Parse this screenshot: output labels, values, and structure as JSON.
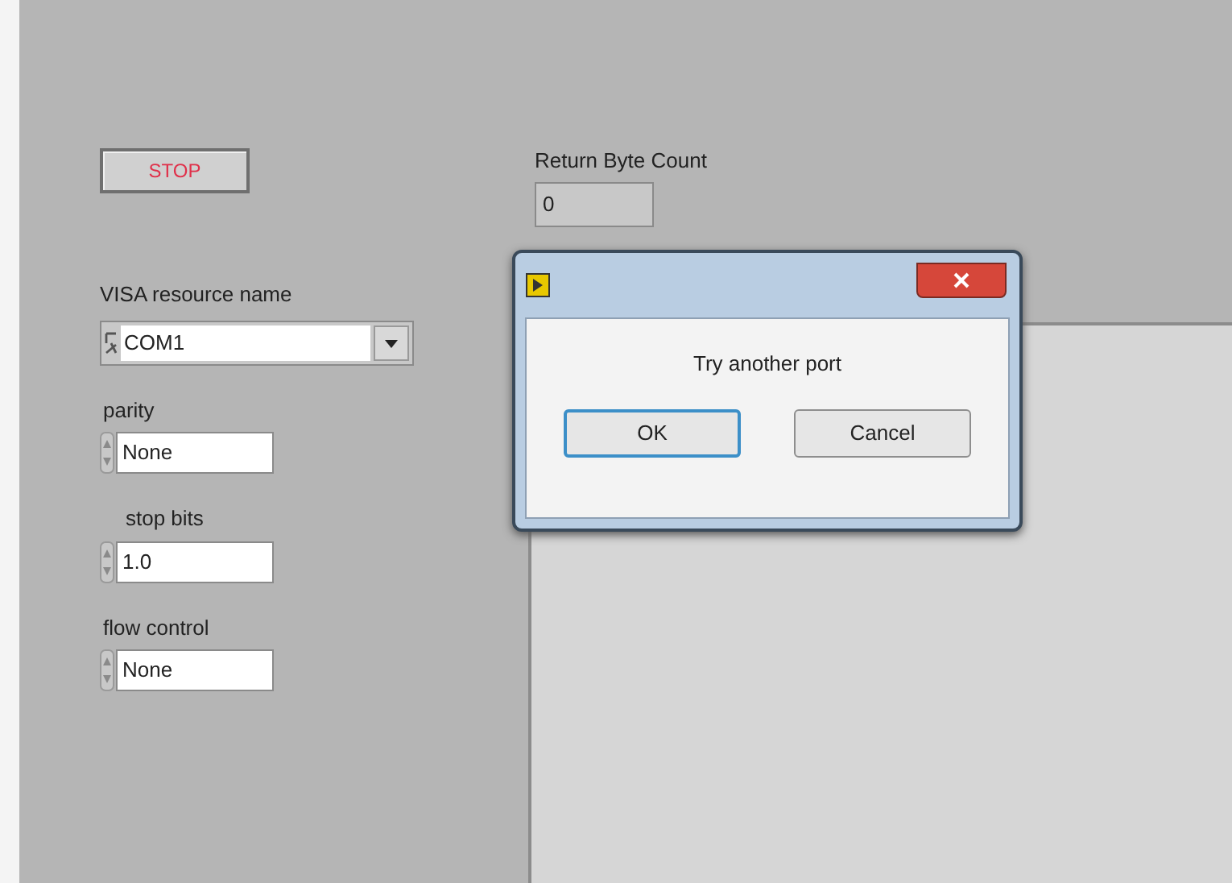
{
  "stop_button": {
    "label": "STOP"
  },
  "return_byte_count": {
    "label": "Return Byte Count",
    "value": "0"
  },
  "visa_resource": {
    "label": "VISA resource name",
    "value": "COM1"
  },
  "settings": [
    {
      "label": "parity",
      "value": "None"
    },
    {
      "label": "stop bits",
      "value": "1.0"
    },
    {
      "label": "flow control",
      "value": "None"
    }
  ],
  "dialog": {
    "message": "Try another port",
    "buttons": [
      {
        "label": "OK",
        "focused": true
      },
      {
        "label": "Cancel",
        "focused": false
      }
    ]
  }
}
